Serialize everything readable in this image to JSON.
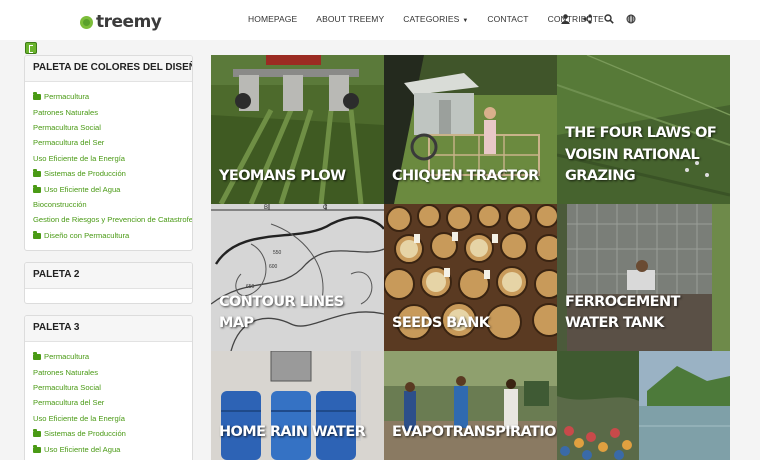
{
  "brand": {
    "name": "treemy"
  },
  "nav": [
    {
      "label": "HOMEPAGE"
    },
    {
      "label": "ABOUT TREEMY"
    },
    {
      "label": "CATEGORIES",
      "has_dropdown": true
    },
    {
      "label": "CONTACT"
    },
    {
      "label": "CONTRIBUTE"
    }
  ],
  "header_icons": [
    "user-icon",
    "share-icon",
    "search-icon",
    "globe-icon"
  ],
  "colors": {
    "accent": "#4a9a15",
    "brand_green": "#7cbd3a"
  },
  "panels": [
    {
      "title": "PALETA DE COLORES DEL DISEÑADOR",
      "items": [
        {
          "label": "Permacultura",
          "folder": true
        },
        {
          "label": "Patrones Naturales",
          "folder": false
        },
        {
          "label": "Permacultura Social",
          "folder": false
        },
        {
          "label": "Permacultura del Ser",
          "folder": false
        },
        {
          "label": "Uso Eficiente de la Energía",
          "folder": false
        },
        {
          "label": "Sistemas de Producción",
          "folder": true
        },
        {
          "label": "Uso Eficiente del Agua",
          "folder": true
        },
        {
          "label": "Bioconstrucción",
          "folder": false
        },
        {
          "label": "Gestion de Riesgos y Prevencion de Catastrofes",
          "folder": false
        },
        {
          "label": "Diseño con Permacultura",
          "folder": true
        }
      ]
    },
    {
      "title": "PALETA 2",
      "items": []
    },
    {
      "title": "PALETA 3",
      "items": [
        {
          "label": "Permacultura",
          "folder": true
        },
        {
          "label": "Patrones Naturales",
          "folder": false
        },
        {
          "label": "Permacultura Social",
          "folder": false
        },
        {
          "label": "Permacultura del Ser",
          "folder": false
        },
        {
          "label": "Uso Eficiente de la Energía",
          "folder": false
        },
        {
          "label": "Sistemas de Producción",
          "folder": true
        },
        {
          "label": "Uso Eficiente del Agua",
          "folder": true
        }
      ]
    }
  ],
  "tiles": [
    {
      "title": "YEOMANS PLOW"
    },
    {
      "title": "CHIQUEN TRACTOR"
    },
    {
      "title": "THE FOUR LAWS OF VOISIN RATIONAL GRAZING"
    },
    {
      "title": "CONTOUR LINES MAP"
    },
    {
      "title": "SEEDS BANK"
    },
    {
      "title": "FERROCEMENT WATER TANK"
    },
    {
      "title": "HOME RAIN WATER"
    },
    {
      "title": "EVAPOTRANSPIRATION"
    },
    {
      "title": ""
    }
  ]
}
